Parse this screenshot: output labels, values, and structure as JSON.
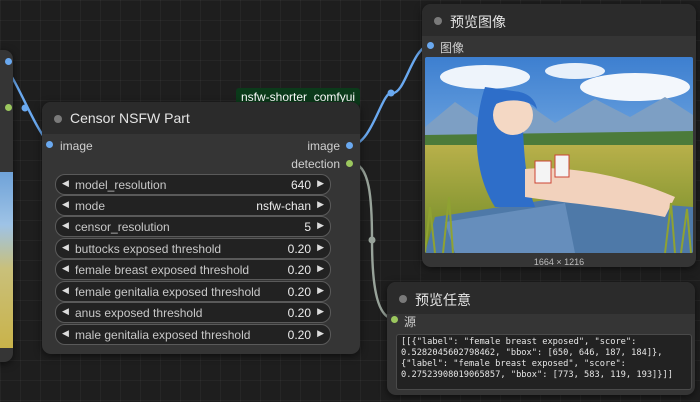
{
  "badge_label": "nsfw-shorter_comfyui",
  "censor_node": {
    "title": "Censor NSFW Part",
    "input_image_label": "image",
    "output_image_label": "image",
    "output_detection_label": "detection",
    "widgets": [
      {
        "name": "model_resolution",
        "value": "640"
      },
      {
        "name": "mode",
        "value": "nsfw-chan"
      },
      {
        "name": "censor_resolution",
        "value": "5"
      },
      {
        "name": "buttocks exposed threshold",
        "value": "0.20"
      },
      {
        "name": "female breast exposed threshold",
        "value": "0.20"
      },
      {
        "name": "female genitalia exposed threshold",
        "value": "0.20"
      },
      {
        "name": "anus exposed threshold",
        "value": "0.20"
      },
      {
        "name": "male genitalia exposed threshold",
        "value": "0.20"
      }
    ]
  },
  "preview_image_node": {
    "title": "预览图像",
    "input_label": "图像",
    "image_size": "1664 × 1216"
  },
  "preview_any_node": {
    "title": "预览任意",
    "input_label": "源",
    "text": "[[{\"label\": \"female breast exposed\", \"score\":\n0.5282045602798462, \"bbox\": [650, 646, 187, 184]},\n{\"label\": \"female breast exposed\", \"score\":\n0.27523908019065857, \"bbox\": [773, 583, 119, 193]}]]"
  },
  "colors": {
    "image_slot": "#6aa9f0",
    "detection_slot": "#9bc75e",
    "any_slot": "#9bc75e",
    "image_link": "#6aa9f0",
    "detection_link": "#98a39a"
  }
}
